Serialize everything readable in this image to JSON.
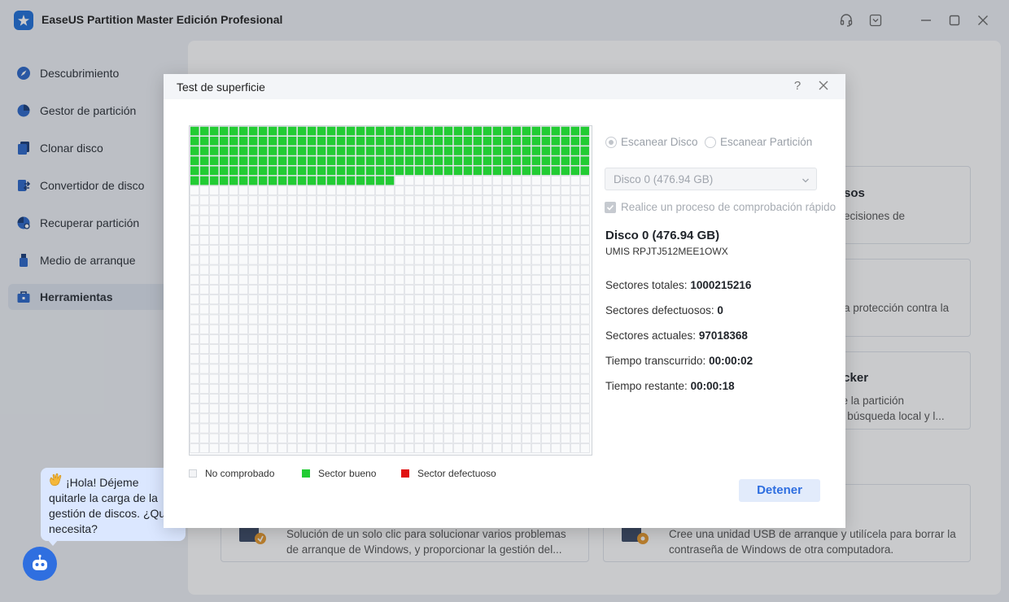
{
  "app": {
    "title": "EaseUS Partition Master Edición Profesional"
  },
  "sidebar": {
    "items": [
      {
        "label": "Descubrimiento",
        "icon": "compass-icon",
        "active": false
      },
      {
        "label": "Gestor de partición",
        "icon": "pie-chart-icon",
        "active": false
      },
      {
        "label": "Clonar disco",
        "icon": "clone-icon",
        "active": false
      },
      {
        "label": "Convertidor de disco",
        "icon": "convert-icon",
        "active": false
      },
      {
        "label": "Recuperar partición",
        "icon": "recover-icon",
        "active": false
      },
      {
        "label": "Medio de arranque",
        "icon": "usb-icon",
        "active": false
      },
      {
        "label": "Herramientas",
        "icon": "toolbox-icon",
        "active": true
      }
    ]
  },
  "background_cards": {
    "card1": {
      "title": "sos",
      "desc1": "ecisiones de"
    },
    "card2": {
      "desc1": "a protección contra la"
    },
    "card3": {
      "title": "ocker",
      "desc1": "de la partición",
      "desc2": "la búsqueda local y l..."
    },
    "card4": {
      "desc1": "Solución de un solo clic para solucionar varios problemas",
      "desc2": "de arranque de Windows, y proporcionar la gestión del..."
    },
    "card5": {
      "desc1": "Cree una unidad USB de arranque y utilícela para borrar la",
      "desc2": "contraseña de Windows de otra computadora."
    }
  },
  "assistant": {
    "message_line1": "¡Hola! Déjeme",
    "message_line2": "quitarle la carga de la",
    "message_line3": "gestión de discos. ¿Qué",
    "message_line4": "necesita?"
  },
  "dialog": {
    "title": "Test de superficie",
    "help_glyph": "?",
    "grid": {
      "columns": 41,
      "rows": 33,
      "good_cells": 226,
      "bad_cells": 0
    },
    "legend": {
      "unchecked": "No comprobado",
      "good": "Sector bueno",
      "bad": "Sector defectuoso"
    },
    "colors": {
      "good": "#22cc33",
      "bad": "#e01010",
      "unchecked": "#f9fafb",
      "accent": "#2e6ee0"
    },
    "scan_disk_label": "Escanear Disco",
    "scan_partition_label": "Escanear Partición",
    "disk_select_value": "Disco 0 (476.94 GB)",
    "quick_check_label": "Realice un proceso de comprobación rápido",
    "disk_name": "Disco 0 (476.94 GB)",
    "disk_model": "UMIS RPJTJ512MEE1OWX",
    "stats": {
      "total_label": "Sectores totales:",
      "total_value": "1000215216",
      "bad_label": "Sectores defectuosos:",
      "bad_value": "0",
      "current_label": "Sectores actuales:",
      "current_value": "97018368",
      "elapsed_label": "Tiempo transcurrido:",
      "elapsed_value": "00:00:02",
      "remaining_label": "Tiempo restante:",
      "remaining_value": "00:00:18"
    },
    "stop_label": "Detener"
  }
}
